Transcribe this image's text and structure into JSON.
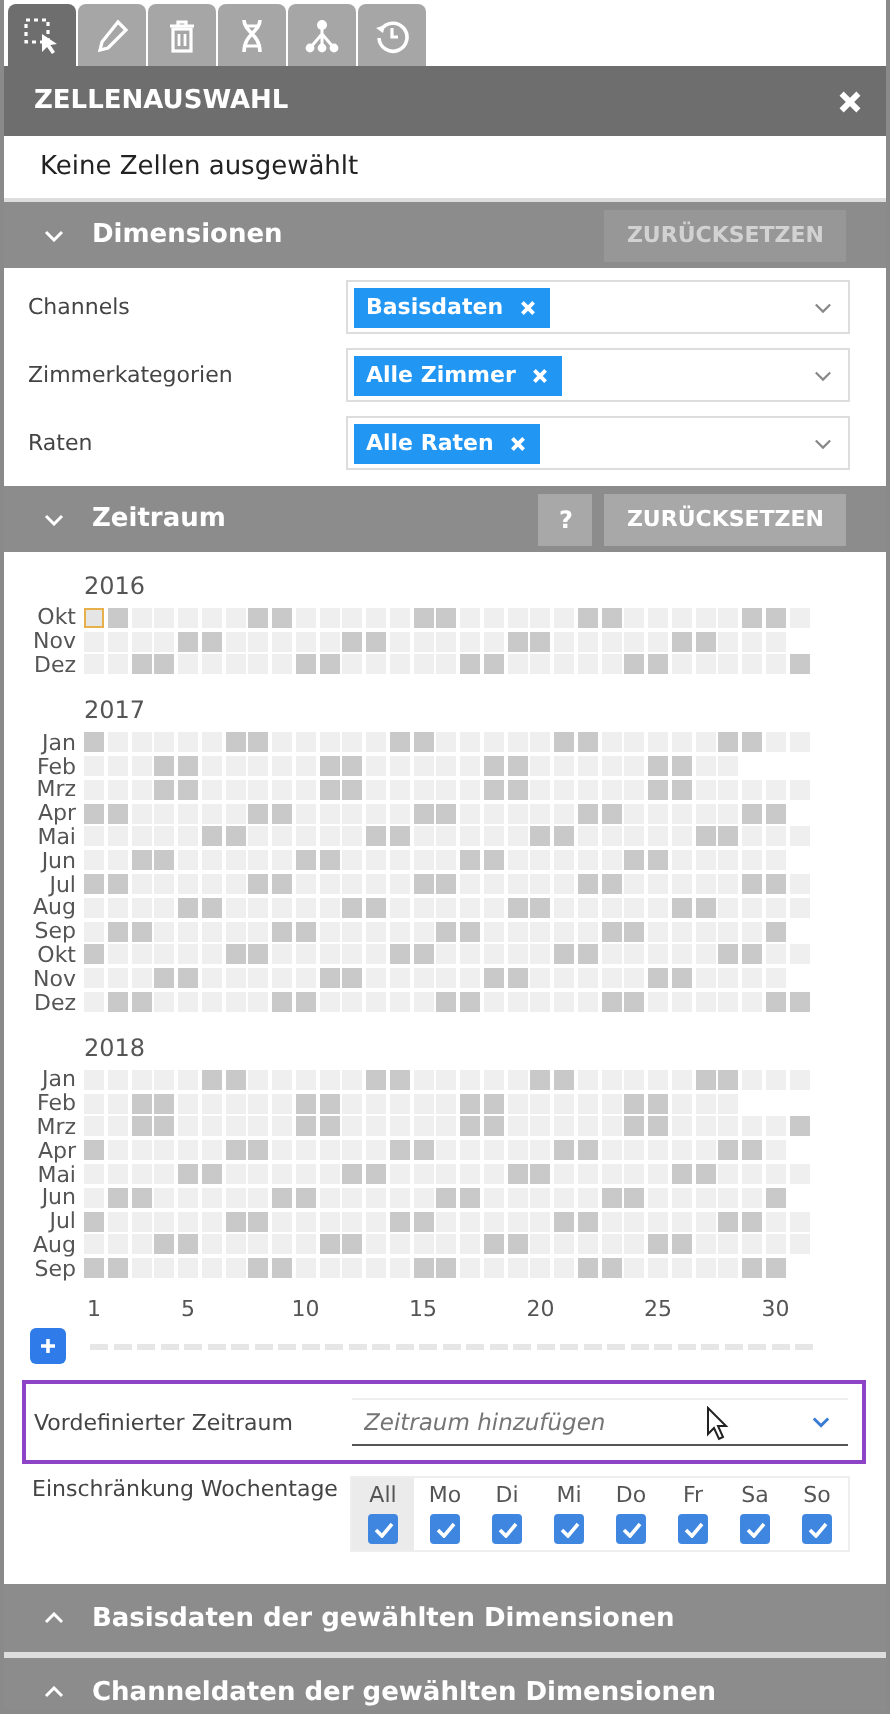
{
  "tabs": [
    {
      "selected": true
    },
    {
      "selected": false
    },
    {
      "selected": false
    },
    {
      "selected": false
    },
    {
      "selected": false
    },
    {
      "selected": false
    }
  ],
  "panel": {
    "title": "ZELLENAUSWAHL",
    "status": "Keine Zellen ausgewählt"
  },
  "dimensions": {
    "title": "Dimensionen",
    "expanded": true,
    "reset": {
      "label": "ZURÜCKSETZEN",
      "disabled": true
    },
    "fields": [
      {
        "label": "Channels",
        "tags": [
          "Basisdaten"
        ]
      },
      {
        "label": "Zimmerkategorien",
        "tags": [
          "Alle Zimmer"
        ]
      },
      {
        "label": "Raten",
        "tags": [
          "Alle Raten"
        ]
      }
    ]
  },
  "period": {
    "title": "Zeitraum",
    "expanded": true,
    "help": "?",
    "reset": {
      "label": "ZURÜCKSETZEN",
      "disabled": false
    },
    "years": [
      {
        "label": "2016",
        "months": [
          {
            "label": "Okt",
            "first_day_focused": true,
            "days": [
              true,
              true,
              false,
              false,
              false,
              false,
              false,
              true,
              true,
              false,
              false,
              false,
              false,
              false,
              true,
              true,
              false,
              false,
              false,
              false,
              false,
              true,
              true,
              false,
              false,
              false,
              false,
              false,
              true,
              true,
              false
            ]
          },
          {
            "label": "Nov",
            "days": [
              false,
              false,
              false,
              false,
              true,
              true,
              false,
              false,
              false,
              false,
              false,
              true,
              true,
              false,
              false,
              false,
              false,
              false,
              true,
              true,
              false,
              false,
              false,
              false,
              false,
              true,
              true,
              false,
              false,
              false
            ]
          },
          {
            "label": "Dez",
            "days": [
              false,
              false,
              true,
              true,
              false,
              false,
              false,
              false,
              false,
              true,
              true,
              false,
              false,
              false,
              false,
              false,
              true,
              true,
              false,
              false,
              false,
              false,
              false,
              true,
              true,
              false,
              false,
              false,
              false,
              false,
              true
            ]
          }
        ]
      },
      {
        "label": "2017",
        "months": [
          {
            "label": "Jan",
            "days": [
              true,
              false,
              false,
              false,
              false,
              false,
              true,
              true,
              false,
              false,
              false,
              false,
              false,
              true,
              true,
              false,
              false,
              false,
              false,
              false,
              true,
              true,
              false,
              false,
              false,
              false,
              false,
              true,
              true,
              false,
              false
            ]
          },
          {
            "label": "Feb",
            "days": [
              false,
              false,
              false,
              true,
              true,
              false,
              false,
              false,
              false,
              false,
              true,
              true,
              false,
              false,
              false,
              false,
              false,
              true,
              true,
              false,
              false,
              false,
              false,
              false,
              true,
              true,
              false,
              false
            ]
          },
          {
            "label": "Mrz",
            "days": [
              false,
              false,
              false,
              true,
              true,
              false,
              false,
              false,
              false,
              false,
              true,
              true,
              false,
              false,
              false,
              false,
              false,
              true,
              true,
              false,
              false,
              false,
              false,
              false,
              true,
              true,
              false,
              false,
              false,
              false,
              false
            ]
          },
          {
            "label": "Apr",
            "days": [
              true,
              true,
              false,
              false,
              false,
              false,
              false,
              true,
              true,
              false,
              false,
              false,
              false,
              false,
              true,
              true,
              false,
              false,
              false,
              false,
              false,
              true,
              true,
              false,
              false,
              false,
              false,
              false,
              true,
              true
            ]
          },
          {
            "label": "Mai",
            "days": [
              false,
              false,
              false,
              false,
              false,
              true,
              true,
              false,
              false,
              false,
              false,
              false,
              true,
              true,
              false,
              false,
              false,
              false,
              false,
              true,
              true,
              false,
              false,
              false,
              false,
              false,
              true,
              true,
              false,
              false,
              false
            ]
          },
          {
            "label": "Jun",
            "days": [
              false,
              false,
              true,
              true,
              false,
              false,
              false,
              false,
              false,
              true,
              true,
              false,
              false,
              false,
              false,
              false,
              true,
              true,
              false,
              false,
              false,
              false,
              false,
              true,
              true,
              false,
              false,
              false,
              false,
              false
            ]
          },
          {
            "label": "Jul",
            "days": [
              true,
              true,
              false,
              false,
              false,
              false,
              false,
              true,
              true,
              false,
              false,
              false,
              false,
              false,
              true,
              true,
              false,
              false,
              false,
              false,
              false,
              true,
              true,
              false,
              false,
              false,
              false,
              false,
              true,
              true,
              false
            ]
          },
          {
            "label": "Aug",
            "days": [
              false,
              false,
              false,
              false,
              true,
              true,
              false,
              false,
              false,
              false,
              false,
              true,
              true,
              false,
              false,
              false,
              false,
              false,
              true,
              true,
              false,
              false,
              false,
              false,
              false,
              true,
              true,
              false,
              false,
              false,
              false
            ]
          },
          {
            "label": "Sep",
            "days": [
              false,
              true,
              true,
              false,
              false,
              false,
              false,
              false,
              true,
              true,
              false,
              false,
              false,
              false,
              false,
              true,
              true,
              false,
              false,
              false,
              false,
              false,
              true,
              true,
              false,
              false,
              false,
              false,
              false,
              true
            ]
          },
          {
            "label": "Okt",
            "days": [
              true,
              false,
              false,
              false,
              false,
              false,
              true,
              true,
              false,
              false,
              false,
              false,
              false,
              true,
              true,
              false,
              false,
              false,
              false,
              false,
              true,
              true,
              false,
              false,
              false,
              false,
              false,
              true,
              true,
              false,
              false
            ]
          },
          {
            "label": "Nov",
            "days": [
              false,
              false,
              false,
              true,
              true,
              false,
              false,
              false,
              false,
              false,
              true,
              true,
              false,
              false,
              false,
              false,
              false,
              true,
              true,
              false,
              false,
              false,
              false,
              false,
              true,
              true,
              false,
              false,
              false,
              false
            ]
          },
          {
            "label": "Dez",
            "days": [
              false,
              true,
              true,
              false,
              false,
              false,
              false,
              false,
              true,
              true,
              false,
              false,
              false,
              false,
              false,
              true,
              true,
              false,
              false,
              false,
              false,
              false,
              true,
              true,
              false,
              false,
              false,
              false,
              false,
              true,
              true
            ]
          }
        ]
      },
      {
        "label": "2018",
        "months": [
          {
            "label": "Jan",
            "days": [
              false,
              false,
              false,
              false,
              false,
              true,
              true,
              false,
              false,
              false,
              false,
              false,
              true,
              true,
              false,
              false,
              false,
              false,
              false,
              true,
              true,
              false,
              false,
              false,
              false,
              false,
              true,
              true,
              false,
              false,
              false
            ]
          },
          {
            "label": "Feb",
            "days": [
              false,
              false,
              true,
              true,
              false,
              false,
              false,
              false,
              false,
              true,
              true,
              false,
              false,
              false,
              false,
              false,
              true,
              true,
              false,
              false,
              false,
              false,
              false,
              true,
              true,
              false,
              false,
              false
            ]
          },
          {
            "label": "Mrz",
            "days": [
              false,
              false,
              true,
              true,
              false,
              false,
              false,
              false,
              false,
              true,
              true,
              false,
              false,
              false,
              false,
              false,
              true,
              true,
              false,
              false,
              false,
              false,
              false,
              true,
              true,
              false,
              false,
              false,
              false,
              false,
              true
            ]
          },
          {
            "label": "Apr",
            "days": [
              true,
              false,
              false,
              false,
              false,
              false,
              true,
              true,
              false,
              false,
              false,
              false,
              false,
              true,
              true,
              false,
              false,
              false,
              false,
              false,
              true,
              true,
              false,
              false,
              false,
              false,
              false,
              true,
              true,
              false
            ]
          },
          {
            "label": "Mai",
            "days": [
              false,
              false,
              false,
              false,
              true,
              true,
              false,
              false,
              false,
              false,
              false,
              true,
              true,
              false,
              false,
              false,
              false,
              false,
              true,
              true,
              false,
              false,
              false,
              false,
              false,
              true,
              true,
              false,
              false,
              false,
              false
            ]
          },
          {
            "label": "Jun",
            "days": [
              false,
              true,
              true,
              false,
              false,
              false,
              false,
              false,
              true,
              true,
              false,
              false,
              false,
              false,
              false,
              true,
              true,
              false,
              false,
              false,
              false,
              false,
              true,
              true,
              false,
              false,
              false,
              false,
              false,
              true
            ]
          },
          {
            "label": "Jul",
            "days": [
              true,
              false,
              false,
              false,
              false,
              false,
              true,
              true,
              false,
              false,
              false,
              false,
              false,
              true,
              true,
              false,
              false,
              false,
              false,
              false,
              true,
              true,
              false,
              false,
              false,
              false,
              false,
              true,
              true,
              false,
              false
            ]
          },
          {
            "label": "Aug",
            "days": [
              false,
              false,
              false,
              true,
              true,
              false,
              false,
              false,
              false,
              false,
              true,
              true,
              false,
              false,
              false,
              false,
              false,
              true,
              true,
              false,
              false,
              false,
              false,
              false,
              true,
              true,
              false,
              false,
              false,
              false,
              false
            ]
          },
          {
            "label": "Sep",
            "days": [
              true,
              true,
              false,
              false,
              false,
              false,
              false,
              true,
              true,
              false,
              false,
              false,
              false,
              false,
              true,
              true,
              false,
              false,
              false,
              false,
              false,
              true,
              true,
              false,
              false,
              false,
              false,
              false,
              true,
              true
            ]
          }
        ]
      }
    ],
    "day_ticks": [
      "1",
      "5",
      "10",
      "15",
      "20",
      "25",
      "30"
    ],
    "predefined": {
      "label": "Vordefinierter Zeitraum",
      "placeholder": "Zeitraum hinzufügen",
      "focused": true
    },
    "weekdays": {
      "label": "Einschränkung Wochentage",
      "days": [
        {
          "label": "All",
          "checked": true,
          "selected": true
        },
        {
          "label": "Mo",
          "checked": true,
          "selected": false
        },
        {
          "label": "Di",
          "checked": true,
          "selected": false
        },
        {
          "label": "Mi",
          "checked": true,
          "selected": false
        },
        {
          "label": "Do",
          "checked": true,
          "selected": false
        },
        {
          "label": "Fr",
          "checked": true,
          "selected": false
        },
        {
          "label": "Sa",
          "checked": true,
          "selected": false
        },
        {
          "label": "So",
          "checked": true,
          "selected": false
        }
      ]
    }
  },
  "collapsed_sections": [
    {
      "title": "Basisdaten der gewählten Dimensionen",
      "expanded": false
    },
    {
      "title": "Channeldaten der gewählten Dimensionen",
      "expanded": false
    }
  ]
}
